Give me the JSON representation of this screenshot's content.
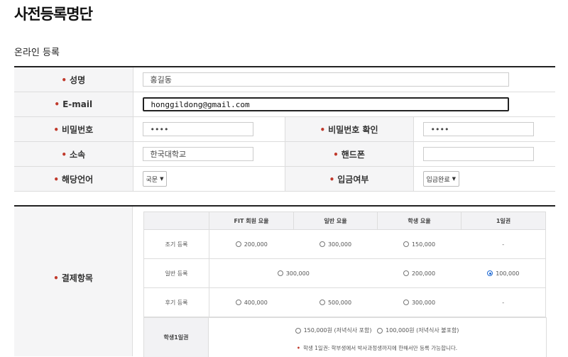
{
  "page_title": "사전등록명단",
  "section_title": "온라인 등록",
  "form": {
    "name_label": "성명",
    "name_value": "홍길동",
    "email_label": "E-mail",
    "email_value": "honggildong@gmail.com",
    "password_label": "비밀번호",
    "password_value": "••••",
    "password_confirm_label": "비밀번호 확인",
    "password_confirm_value": "••••",
    "affiliation_label": "소속",
    "affiliation_value": "한국대학교",
    "phone_label": "핸드폰",
    "phone_value": "",
    "language_label": "해당언어",
    "language_value": "국문",
    "payment_status_label": "입금여부",
    "payment_status_value": "입금완료"
  },
  "payment": {
    "label": "결제항목",
    "headers": [
      "",
      "FIT 회원 요율",
      "일반 요율",
      "학생 요율",
      "1일권"
    ],
    "rows": [
      {
        "name": "조기 등록",
        "fit": "200,000",
        "general": "300,000",
        "student": "150,000",
        "day": "-"
      },
      {
        "name": "일반 등록",
        "merged": "300,000",
        "student": "200,000",
        "day": "100,000"
      },
      {
        "name": "후기 등록",
        "fit": "400,000",
        "general": "500,000",
        "student": "300,000",
        "day": "-"
      }
    ],
    "selected": "일반 등록 / 1일권",
    "student_day": {
      "label": "학생1일권",
      "option1": "150,000원 (저녁식사 포함)",
      "option2": "100,000원 (저녁식사 불포함)",
      "note": "학생 1일권: 학부생에서 박사과정생까지에 한해서만 등록 가능합니다."
    }
  },
  "colors": {
    "accent": "#1a66d2",
    "required_dot": "#c0392b",
    "label_bg": "#f5f5f6"
  }
}
